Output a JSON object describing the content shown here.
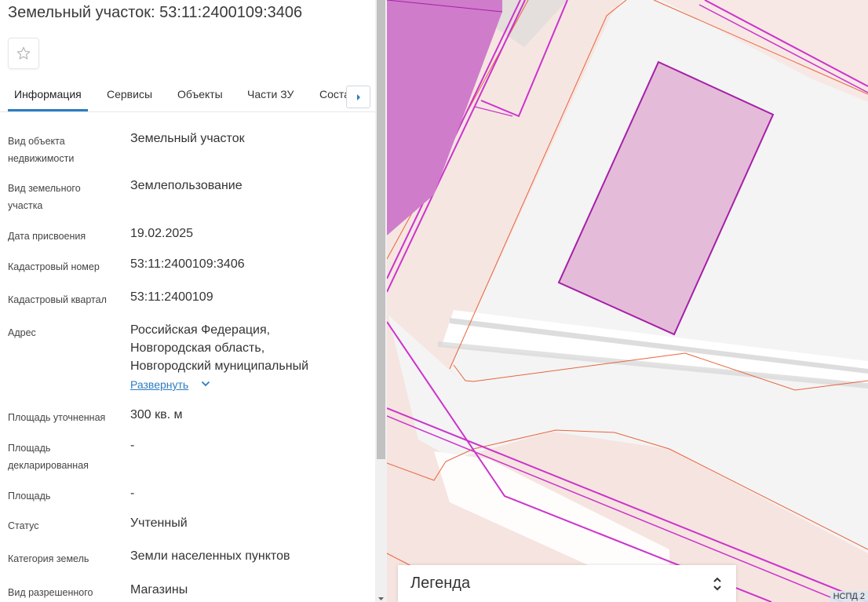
{
  "title": "Земельный участок: 53:11:2400109:3406",
  "tabs": [
    {
      "label": "Информация"
    },
    {
      "label": "Сервисы"
    },
    {
      "label": "Объекты"
    },
    {
      "label": "Части ЗУ"
    },
    {
      "label": "Соста"
    }
  ],
  "fields": {
    "object_type": {
      "label_line1": "Вид объекта",
      "label_line2": "недвижимости",
      "value": "Земельный участок"
    },
    "land_type": {
      "label_line1": "Вид земельного",
      "label_line2": "участка",
      "value": "Землепользование"
    },
    "date": {
      "label": "Дата присвоения",
      "value": "19.02.2025"
    },
    "cad_number": {
      "label": "Кадастровый номер",
      "value": "53:11:2400109:3406"
    },
    "cad_quarter": {
      "label": "Кадастровый квартал",
      "value": "53:11:2400109"
    },
    "address": {
      "label": "Адрес",
      "line1": "Российская Федерация,",
      "line2": "Новгородская область,",
      "line3": "Новгородский муниципальный",
      "expand": "Развернуть"
    },
    "area_precise": {
      "label": "Площадь уточненная",
      "value": "300 кв. м"
    },
    "area_declared": {
      "label_line1": "Площадь",
      "label_line2": "декларированная",
      "value": "-"
    },
    "area": {
      "label": "Площадь",
      "value": "-"
    },
    "status": {
      "label": "Статус",
      "value": "Учтенный"
    },
    "category": {
      "label": "Категория земель",
      "value": "Земли населенных пунктов"
    },
    "permitted_use": {
      "label": "Вид разрешенного",
      "value": "Магазины"
    }
  },
  "map": {
    "legend_title": "Легенда",
    "watermark": "НСПД 2"
  },
  "colors": {
    "accent": "#2c7cc1",
    "parcel_fill": "#e4bcd9",
    "parcel_stroke": "#a61fa8",
    "zone_fill": "#f6e5e2",
    "zone_line": "#e8643c",
    "building_fill": "#cf7ccb"
  }
}
